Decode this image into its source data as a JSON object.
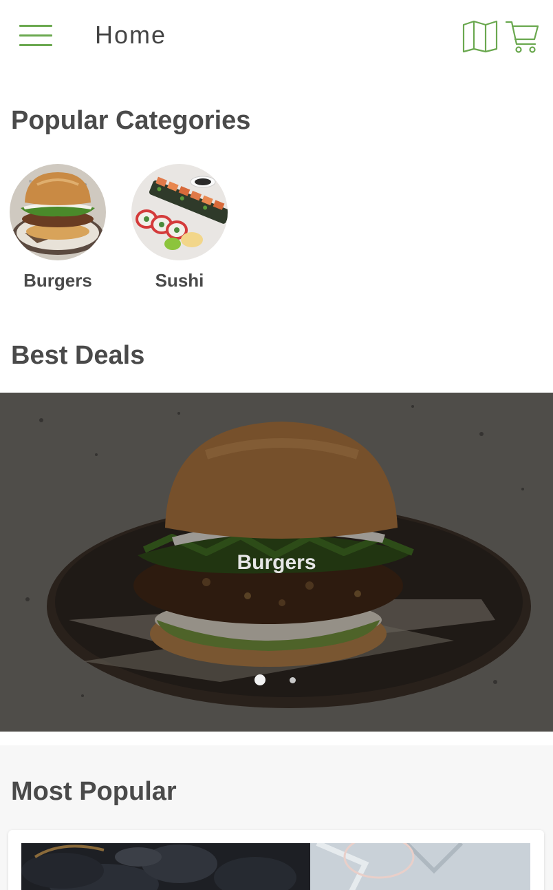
{
  "header": {
    "title": "Home",
    "menu_icon": "hamburger-menu-icon",
    "map_icon": "map-icon",
    "cart_icon": "cart-icon",
    "accent_color": "#6aa84f"
  },
  "popular_categories": {
    "title": "Popular Categories",
    "items": [
      {
        "label": "Burgers",
        "image": "burger-photo"
      },
      {
        "label": "Sushi",
        "image": "sushi-photo"
      }
    ]
  },
  "best_deals": {
    "title": "Best Deals",
    "slides": [
      {
        "label": "Burgers",
        "image": "burger-on-plate-photo"
      }
    ],
    "active_slide": 1,
    "slide_count": 2
  },
  "most_popular": {
    "title": "Most Popular",
    "items": [
      {
        "image": "mussels-photo"
      }
    ]
  }
}
